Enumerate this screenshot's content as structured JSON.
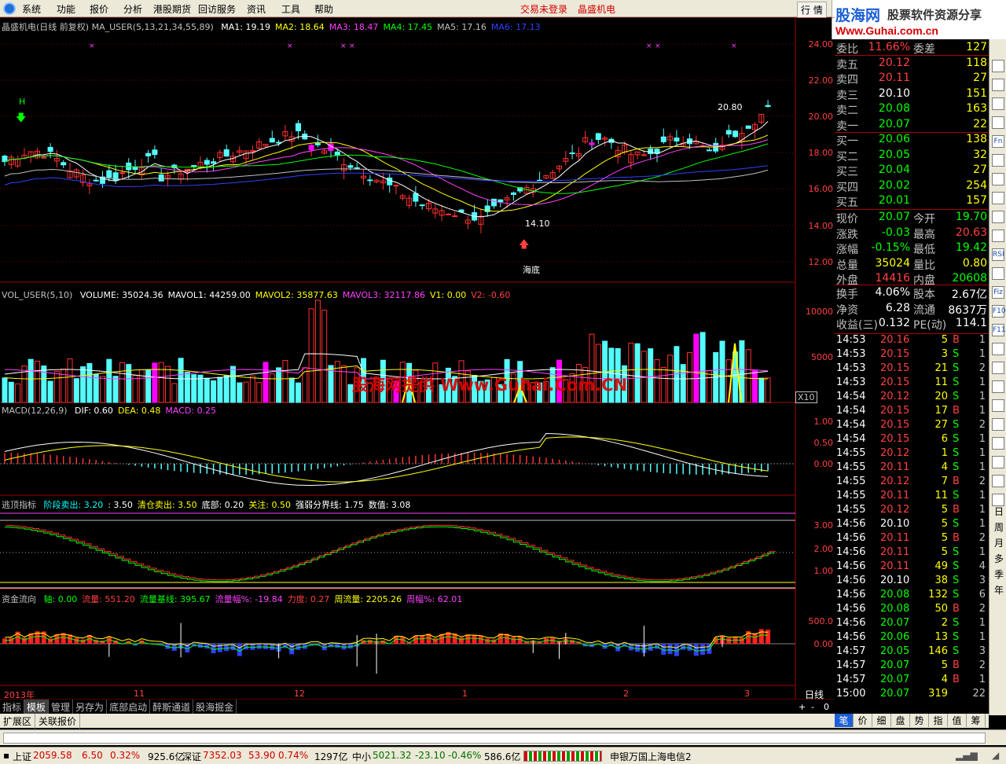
{
  "menu": {
    "items": [
      "系统",
      "功能",
      "报价",
      "分析",
      "港股期货",
      "回访服务",
      "资讯",
      "工具",
      "帮助"
    ],
    "status": "交易未登录",
    "stock": "晶盛机电",
    "right_buttons": [
      "行",
      "情"
    ]
  },
  "brand": {
    "logo_text": "股海网",
    "slogan": "股票软件资源分享",
    "url": "Www.Guhai.com.cn"
  },
  "price_panel": {
    "title": "晶盛机电(日线 前复权) MA_USER(5,13,21,34,55,89)",
    "ma": [
      {
        "label": "MA1: 19.19",
        "color": "#ffffff"
      },
      {
        "label": "MA2: 18.64",
        "color": "#ffff00"
      },
      {
        "label": "MA3: 18.47",
        "color": "#ff40ff"
      },
      {
        "label": "MA4: 17.45",
        "color": "#00ff00"
      },
      {
        "label": "MA5: 17.16",
        "color": "#c0c0c0"
      },
      {
        "label": "MA6: 17.13",
        "color": "#3040ff"
      }
    ],
    "y_ticks": [
      "24.00",
      "22.00",
      "20.00",
      "18.00",
      "16.00",
      "14.00",
      "12.00"
    ],
    "high_label": "20.80",
    "low_label": "14.10",
    "signal_h": "H",
    "bottom_label": "海底"
  },
  "vol_panel": {
    "title": "VOL_USER(5,10)",
    "items": [
      {
        "label": "VOLUME: 35024.36",
        "color": "#ffffff"
      },
      {
        "label": "MAVOL1: 44259.00",
        "color": "#ffffff"
      },
      {
        "label": "MAVOL2: 35877.63",
        "color": "#ffff00"
      },
      {
        "label": "MAVOL3: 32117.86",
        "color": "#ff40ff"
      },
      {
        "label": "V1: 0.00",
        "color": "#ffff00"
      },
      {
        "label": "V2: -0.60",
        "color": "#ff4040"
      }
    ],
    "y_ticks": [
      "10000",
      "5000"
    ],
    "unit": "X10",
    "watermark": "股海网提供 Www.Guhai.Com.CN"
  },
  "macd_panel": {
    "title": "MACD(12,26,9)",
    "items": [
      {
        "label": "DIF: 0.60",
        "color": "#ffffff"
      },
      {
        "label": "DEA: 0.48",
        "color": "#ffff00"
      },
      {
        "label": "MACD: 0.25",
        "color": "#ff40ff"
      }
    ],
    "y_ticks": [
      "1.00",
      "0.50",
      "0.00"
    ]
  },
  "escape_panel": {
    "title": "逃顶指标",
    "items": [
      {
        "label": "阶段卖出: 3.20",
        "color": "#00ffff"
      },
      {
        "label": ": 3.50",
        "color": "#ffffff"
      },
      {
        "label": "清仓卖出: 3.50",
        "color": "#ffff00"
      },
      {
        "label": "底部: 0.20",
        "color": "#ffffff"
      },
      {
        "label": "关注: 0.50",
        "color": "#ffff00"
      },
      {
        "label": "强弱分界线: 1.75",
        "color": "#ffffff"
      },
      {
        "label": "数值: 3.08",
        "color": "#ffffff"
      }
    ],
    "y_ticks": [
      "3.00",
      "2.00",
      "1.00"
    ]
  },
  "flow_panel": {
    "title": "资金流向",
    "items": [
      {
        "label": "轴: 0.00",
        "color": "#00ff00"
      },
      {
        "label": "流量: 551.20",
        "color": "#ff4040"
      },
      {
        "label": "流量基线: 395.67",
        "color": "#00ff00"
      },
      {
        "label": "流量幅%: -19.84",
        "color": "#ff40ff"
      },
      {
        "label": "力度: 0.27",
        "color": "#ff4040"
      },
      {
        "label": "周流量: 2205.26",
        "color": "#ffff00"
      },
      {
        "label": "周幅%: 62.01",
        "color": "#ff40ff"
      }
    ],
    "y_ticks": [
      "500.0",
      "0.00"
    ]
  },
  "time_axis": [
    "2013年",
    "11",
    "12",
    "1",
    "2",
    "3"
  ],
  "period": "日线",
  "zoom_controls": [
    "+",
    "-",
    "0"
  ],
  "order_book": [
    {
      "side": "委比",
      "price": "11.66%",
      "label2": "委差",
      "vol": "127",
      "pc": "#ff4040",
      "vc": "#ffff00"
    },
    {
      "side": "卖五",
      "price": "20.12",
      "vol": "118",
      "pc": "#ff4040",
      "vc": "#ffff00"
    },
    {
      "side": "卖四",
      "price": "20.11",
      "vol": "27",
      "pc": "#ff4040",
      "vc": "#ffff00"
    },
    {
      "side": "卖三",
      "price": "20.10",
      "vol": "151",
      "pc": "#ffffff",
      "vc": "#ffff00"
    },
    {
      "side": "卖二",
      "price": "20.08",
      "vol": "163",
      "pc": "#00ff00",
      "vc": "#ffff00"
    },
    {
      "side": "卖一",
      "price": "20.07",
      "vol": "22",
      "pc": "#00ff00",
      "vc": "#ffff00"
    },
    {
      "side": "买一",
      "price": "20.06",
      "vol": "138",
      "pc": "#00ff00",
      "vc": "#ffff00"
    },
    {
      "side": "买二",
      "price": "20.05",
      "vol": "32",
      "pc": "#00ff00",
      "vc": "#ffff00"
    },
    {
      "side": "买三",
      "price": "20.04",
      "vol": "27",
      "pc": "#00ff00",
      "vc": "#ffff00"
    },
    {
      "side": "买四",
      "price": "20.02",
      "vol": "254",
      "pc": "#00ff00",
      "vc": "#ffff00"
    },
    {
      "side": "买五",
      "price": "20.01",
      "vol": "157",
      "pc": "#00ff00",
      "vc": "#ffff00"
    }
  ],
  "stats": [
    {
      "a": "现价",
      "b": "20.07",
      "bc": "#00ff00",
      "c": "今开",
      "d": "19.70",
      "dc": "#00ff00"
    },
    {
      "a": "涨跌",
      "b": "-0.03",
      "bc": "#00ff00",
      "c": "最高",
      "d": "20.63",
      "dc": "#ff4040"
    },
    {
      "a": "涨幅",
      "b": "-0.15%",
      "bc": "#00ff00",
      "c": "最低",
      "d": "19.42",
      "dc": "#00ff00"
    },
    {
      "a": "总量",
      "b": "35024",
      "bc": "#ffff00",
      "c": "量比",
      "d": "0.80",
      "dc": "#ffff00"
    },
    {
      "a": "外盘",
      "b": "14416",
      "bc": "#ff4040",
      "c": "内盘",
      "d": "20608",
      "dc": "#00ff00"
    }
  ],
  "stats2": [
    {
      "a": "换手",
      "b": "4.06%",
      "c": "股本",
      "d": "2.67亿"
    },
    {
      "a": "净资",
      "b": "6.28",
      "c": "流通",
      "d": "8637万"
    },
    {
      "a": "收益(三)",
      "b": "0.132",
      "c": "PE(动)",
      "d": "114.1"
    }
  ],
  "ticks": [
    {
      "t": "14:53",
      "p": "20.16",
      "v": "5",
      "s": "B",
      "n": "1"
    },
    {
      "t": "14:53",
      "p": "20.15",
      "v": "3",
      "s": "S",
      "n": "1"
    },
    {
      "t": "14:53",
      "p": "20.15",
      "v": "21",
      "s": "S",
      "n": "2"
    },
    {
      "t": "14:53",
      "p": "20.15",
      "v": "11",
      "s": "S",
      "n": "1"
    },
    {
      "t": "14:54",
      "p": "20.12",
      "v": "20",
      "s": "S",
      "n": "1"
    },
    {
      "t": "14:54",
      "p": "20.15",
      "v": "17",
      "s": "B",
      "n": "1"
    },
    {
      "t": "14:54",
      "p": "20.15",
      "v": "27",
      "s": "S",
      "n": "2"
    },
    {
      "t": "14:54",
      "p": "20.15",
      "v": "6",
      "s": "S",
      "n": "1"
    },
    {
      "t": "14:55",
      "p": "20.12",
      "v": "1",
      "s": "S",
      "n": "1"
    },
    {
      "t": "14:55",
      "p": "20.11",
      "v": "4",
      "s": "S",
      "n": "1"
    },
    {
      "t": "14:55",
      "p": "20.12",
      "v": "7",
      "s": "B",
      "n": "2"
    },
    {
      "t": "14:55",
      "p": "20.11",
      "v": "11",
      "s": "S",
      "n": "1"
    },
    {
      "t": "14:55",
      "p": "20.12",
      "v": "5",
      "s": "B",
      "n": "1"
    },
    {
      "t": "14:56",
      "p": "20.10",
      "v": "5",
      "s": "S",
      "n": "1"
    },
    {
      "t": "14:56",
      "p": "20.11",
      "v": "5",
      "s": "B",
      "n": "2"
    },
    {
      "t": "14:56",
      "p": "20.11",
      "v": "5",
      "s": "S",
      "n": "1"
    },
    {
      "t": "14:56",
      "p": "20.11",
      "v": "49",
      "s": "S",
      "n": "4"
    },
    {
      "t": "14:56",
      "p": "20.10",
      "v": "38",
      "s": "S",
      "n": "3"
    },
    {
      "t": "14:56",
      "p": "20.08",
      "v": "132",
      "s": "S",
      "n": "6"
    },
    {
      "t": "14:56",
      "p": "20.08",
      "v": "50",
      "s": "B",
      "n": "2"
    },
    {
      "t": "14:56",
      "p": "20.07",
      "v": "2",
      "s": "S",
      "n": "1"
    },
    {
      "t": "14:56",
      "p": "20.06",
      "v": "13",
      "s": "S",
      "n": "1"
    },
    {
      "t": "14:57",
      "p": "20.05",
      "v": "146",
      "s": "S",
      "n": "3"
    },
    {
      "t": "14:57",
      "p": "20.07",
      "v": "5",
      "s": "B",
      "n": "2"
    },
    {
      "t": "14:57",
      "p": "20.07",
      "v": "4",
      "s": "B",
      "n": "1"
    },
    {
      "t": "15:00",
      "p": "20.07",
      "v": "319",
      "s": "",
      "n": "22"
    }
  ],
  "bottom_tabs": [
    "指标",
    "模板",
    "管理",
    "另存为",
    "底部启动",
    "醉斯通道",
    "股海掘金"
  ],
  "bottom_tabs2": [
    "扩展区",
    "关联报价"
  ],
  "right_tabs": [
    "笔",
    "价",
    "细",
    "盘",
    "势",
    "指",
    "值",
    "筹"
  ],
  "side_icons": [
    "日",
    "周",
    "月",
    "多",
    "季",
    "年"
  ],
  "side_icon_boxes": [
    "Fn",
    "RSI",
    "Fiz",
    "F10",
    "F11"
  ],
  "status": {
    "sh_label": "上证",
    "sh": "2059.58",
    "sh_chg": "6.50",
    "sh_pct": "0.32%",
    "sh_amt": "925.6亿",
    "sz_label": "深证",
    "sz": "7352.03",
    "sz_chg": "53.90",
    "sz_pct": "0.74%",
    "sz_amt": "1297亿",
    "zx_label": "中小",
    "zx": "5021.32",
    "zx_chg": "-23.10",
    "zx_pct": "-0.46%",
    "zx_amt": "586.6亿",
    "server": "申银万国上海电信2"
  }
}
